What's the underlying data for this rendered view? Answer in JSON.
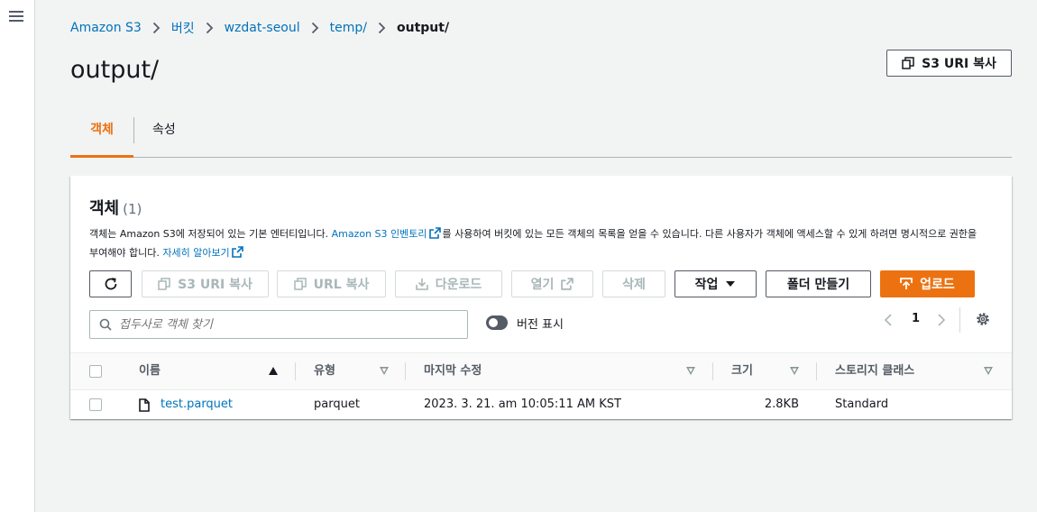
{
  "breadcrumb": {
    "items": [
      "Amazon S3",
      "버킷",
      "wzdat-seoul",
      "temp/"
    ],
    "current": "output/"
  },
  "header": {
    "title": "output/",
    "copy_uri_label": "S3 URI 복사"
  },
  "tabs": [
    {
      "label": "객체",
      "active": true
    },
    {
      "label": "속성",
      "active": false
    }
  ],
  "objects_panel": {
    "title": "객체",
    "count": "(1)",
    "description": {
      "part1": "객체는 Amazon S3에 저장되어 있는 기본 엔터티입니다. ",
      "inventory_link": "Amazon S3 인벤토리",
      "part2": "를 사용하여 버킷에 있는 모든 객체의 목록을 얻을 수 있습니다. 다른 사용자가 객체에 액세스할 수 있게 하려면 명시적으로 권한을 부여해야 합니다. ",
      "learn_more_link": "자세히 알아보기"
    },
    "toolbar": {
      "refresh_icon": "refresh-icon",
      "copy_s3_uri": "S3 URI 복사",
      "copy_url": "URL 복사",
      "download": "다운로드",
      "open": "열기",
      "delete": "삭제",
      "actions": "작업",
      "create_folder": "폴더 만들기",
      "upload": "업로드"
    },
    "search": {
      "placeholder": "접두사로 객체 찾기"
    },
    "show_versions_label": "버전 표시",
    "pagination": {
      "current_page": "1"
    },
    "table": {
      "columns": [
        "이름",
        "유형",
        "마지막 수정",
        "크기",
        "스토리지 클래스"
      ],
      "rows": [
        {
          "name": "test.parquet",
          "type": "parquet",
          "last_modified": "2023. 3. 21. am 10:05:11 AM KST",
          "size": "2.8KB",
          "storage_class": "Standard"
        }
      ]
    }
  },
  "colors": {
    "accent": "#ec7211",
    "link": "#0073bb",
    "text": "#16191f",
    "disabled": "#aab7b8"
  }
}
